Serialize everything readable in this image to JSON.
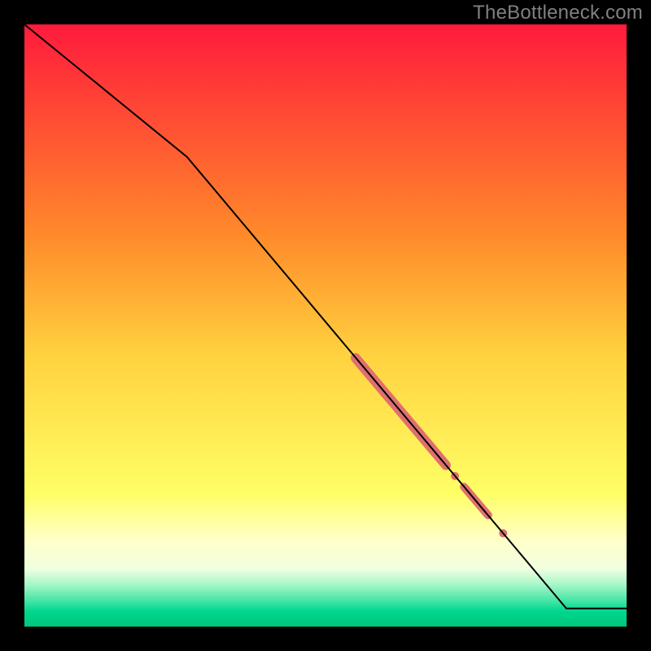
{
  "watermark": "TheBottleneck.com",
  "chart_data": {
    "type": "line",
    "title": "",
    "xlabel": "",
    "ylabel": "",
    "xlim": [
      0,
      100
    ],
    "ylim": [
      0,
      100
    ],
    "gradient_stops": [
      {
        "offset": 0,
        "color": "#ff1a3c"
      },
      {
        "offset": 0.35,
        "color": "#ff8a2a"
      },
      {
        "offset": 0.55,
        "color": "#ffd23f"
      },
      {
        "offset": 0.78,
        "color": "#ffff66"
      },
      {
        "offset": 0.86,
        "color": "#ffffcc"
      },
      {
        "offset": 0.905,
        "color": "#efffe0"
      },
      {
        "offset": 0.93,
        "color": "#a6f7c8"
      },
      {
        "offset": 0.955,
        "color": "#4de6a8"
      },
      {
        "offset": 0.975,
        "color": "#00d68f"
      },
      {
        "offset": 1.0,
        "color": "#00c77a"
      }
    ],
    "series": [
      {
        "name": "curve",
        "stroke": "#000000",
        "stroke_width": 2,
        "points_xy": [
          [
            0,
            100
          ],
          [
            27,
            78
          ],
          [
            90,
            3
          ],
          [
            100,
            3
          ]
        ]
      }
    ],
    "highlights": {
      "color": "#e06f6f",
      "segments_xy": [
        {
          "x1": 55,
          "y1": 44.6,
          "x2": 70,
          "y2": 26.8,
          "thickness": 12
        },
        {
          "x1": 73,
          "y1": 23.2,
          "x2": 77,
          "y2": 18.5,
          "thickness": 10
        }
      ],
      "dots_xy": [
        {
          "x": 71.5,
          "y": 25.0,
          "r": 5
        },
        {
          "x": 79.5,
          "y": 15.5,
          "r": 5
        }
      ]
    }
  }
}
